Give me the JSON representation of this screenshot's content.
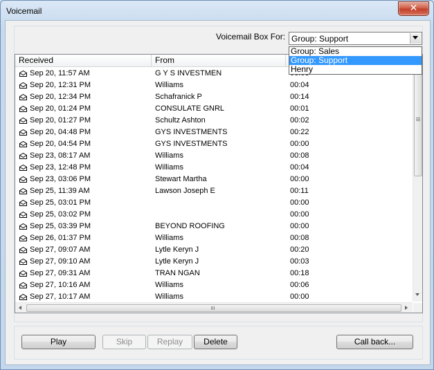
{
  "window": {
    "title": "Voicemail"
  },
  "voicemail_box": {
    "label": "Voicemail Box For:",
    "selected": "Group: Support",
    "options": [
      {
        "label": "Group: Sales",
        "selected": false
      },
      {
        "label": "Group: Support",
        "selected": true
      },
      {
        "label": "Henry",
        "selected": false
      }
    ]
  },
  "table": {
    "columns": [
      "Received",
      "From",
      ""
    ],
    "rows": [
      {
        "received": "Sep 20, 11:57 AM",
        "from": "G Y S INVESTMEN",
        "duration": "00:08"
      },
      {
        "received": "Sep 20, 12:31 PM",
        "from": "Williams",
        "duration": "00:04"
      },
      {
        "received": "Sep 20, 12:34 PM",
        "from": "Schafranick P",
        "duration": "00:14"
      },
      {
        "received": "Sep 20, 01:24 PM",
        "from": "CONSULATE GNRL",
        "duration": "00:01"
      },
      {
        "received": "Sep 20, 01:27 PM",
        "from": "Schultz Ashton",
        "duration": "00:02"
      },
      {
        "received": "Sep 20, 04:48 PM",
        "from": "GYS INVESTMENTS",
        "duration": "00:22"
      },
      {
        "received": "Sep 20, 04:54 PM",
        "from": "GYS INVESTMENTS",
        "duration": "00:00"
      },
      {
        "received": "Sep 23, 08:17 AM",
        "from": "Williams",
        "duration": "00:08"
      },
      {
        "received": "Sep 23, 12:48 PM",
        "from": "Williams",
        "duration": "00:04"
      },
      {
        "received": "Sep 23, 03:06 PM",
        "from": "Stewart Martha",
        "duration": "00:00"
      },
      {
        "received": "Sep 25, 11:39 AM",
        "from": "Lawson Joseph E",
        "duration": "00:11"
      },
      {
        "received": "Sep 25, 03:01 PM",
        "from": "",
        "duration": "00:00"
      },
      {
        "received": "Sep 25, 03:02 PM",
        "from": "",
        "duration": "00:00"
      },
      {
        "received": "Sep 25, 03:39 PM",
        "from": "BEYOND ROOFING",
        "duration": "00:00"
      },
      {
        "received": "Sep 26, 01:37 PM",
        "from": "Williams",
        "duration": "00:08"
      },
      {
        "received": "Sep 27, 09:07 AM",
        "from": "Lytle Keryn J",
        "duration": "00:20"
      },
      {
        "received": "Sep 27, 09:10 AM",
        "from": "Lytle Keryn J",
        "duration": "00:03"
      },
      {
        "received": "Sep 27, 09:31 AM",
        "from": "TRAN NGAN",
        "duration": "00:18"
      },
      {
        "received": "Sep 27, 10:16 AM",
        "from": "Williams",
        "duration": "00:06"
      },
      {
        "received": "Sep 27, 10:17 AM",
        "from": "Williams",
        "duration": "00:00"
      }
    ]
  },
  "buttons": {
    "play": "Play",
    "skip": "Skip",
    "replay": "Replay",
    "delete": "Delete",
    "call_back": "Call back..."
  },
  "icons": {
    "close": "close-icon",
    "row": "envelope-icon"
  },
  "colors": {
    "selection": "#3399ff",
    "close_button": "#c2402a"
  }
}
